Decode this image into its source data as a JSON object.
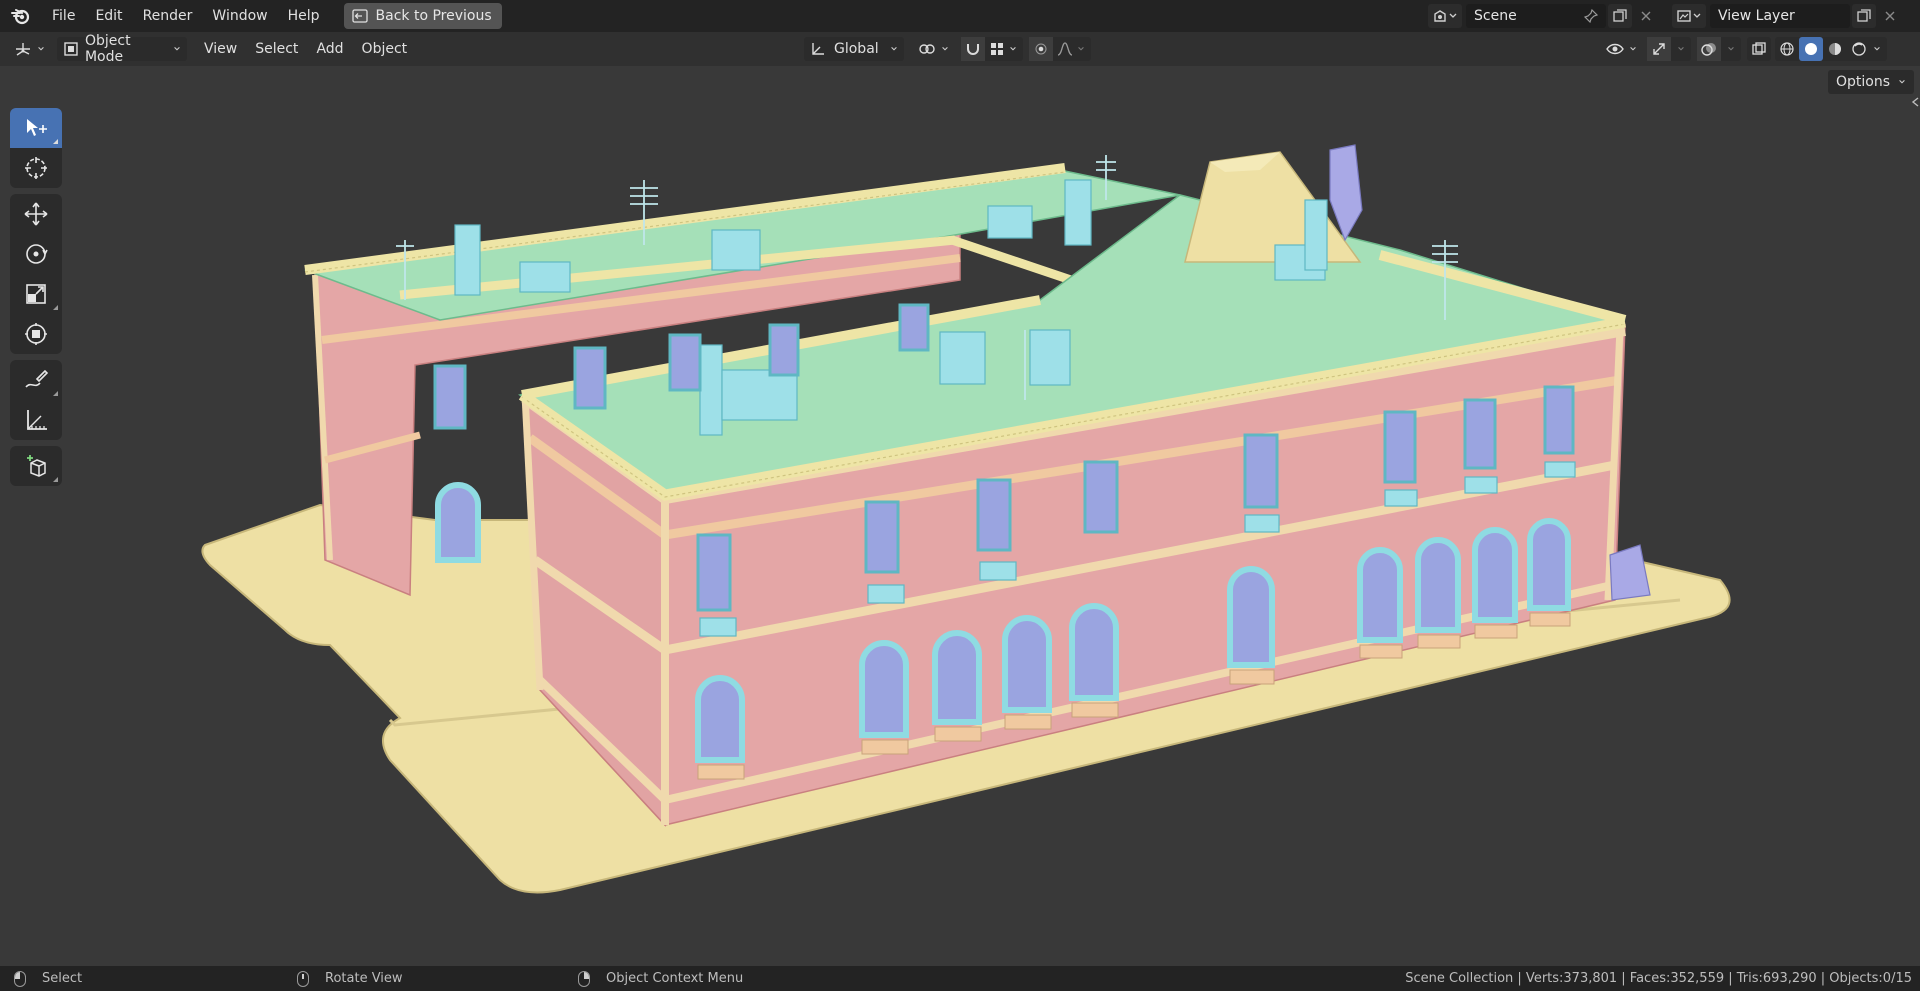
{
  "menubar": {
    "items": [
      "File",
      "Edit",
      "Render",
      "Window",
      "Help"
    ],
    "back_label": "Back to Previous",
    "scene_name": "Scene",
    "view_layer_name": "View Layer"
  },
  "header": {
    "mode_label": "Object Mode",
    "menus": [
      "View",
      "Select",
      "Add",
      "Object"
    ],
    "transform_orientation": "Global",
    "options_label": "Options"
  },
  "toolbar": {
    "tools": [
      "select-box",
      "cursor",
      "move",
      "rotate",
      "scale",
      "transform",
      "annotate",
      "measure",
      "add-cube"
    ],
    "active_tool": "select-box"
  },
  "statusbar": {
    "left_action": "Select",
    "middle_action": "Rotate View",
    "right_action": "Object Context Menu",
    "stats": "Scene Collection | Verts:373,801 | Faces:352,559 | Tris:693,290 | Objects:0/15"
  },
  "colors": {
    "accent": "#4772b3",
    "viewport_bg": "#393939",
    "ground": "#eee0a4",
    "wall": "#e4a6a6",
    "roof": "#a5e0b8",
    "trim": "#9ee0e8",
    "window": "#9aa4e0"
  }
}
